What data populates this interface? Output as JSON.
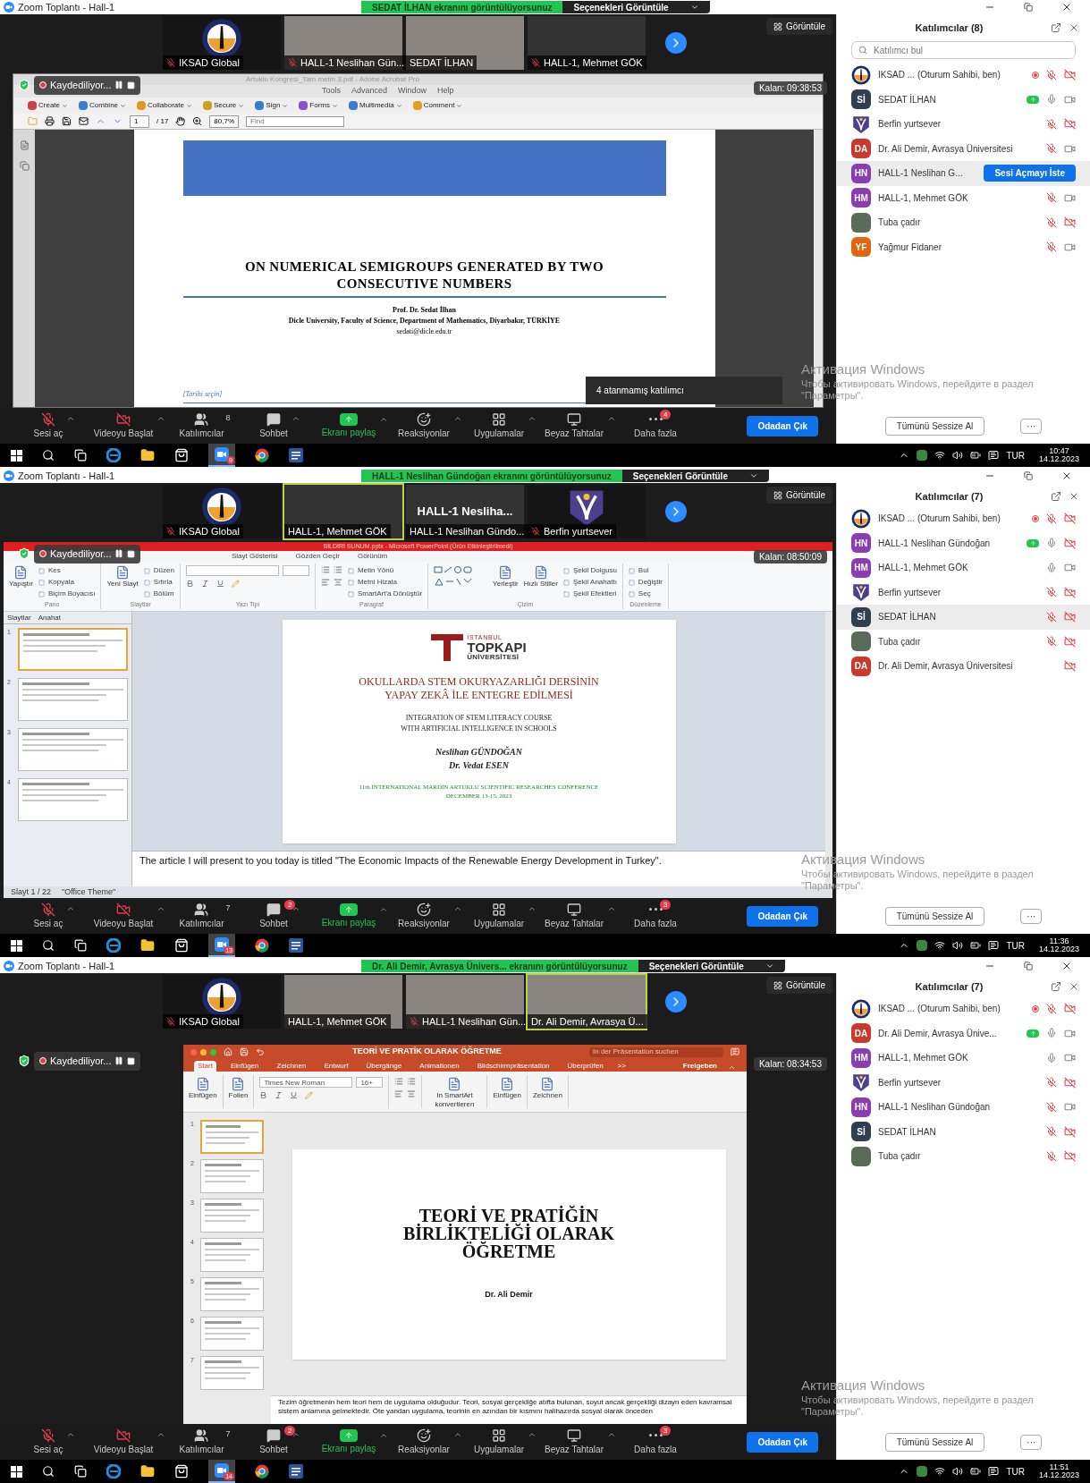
{
  "panels": [
    {
      "window_title": "Zoom Toplantı - Hall-1",
      "banner": "SEDAT İLHAN ekranını görüntülüyorsunuz",
      "options": "Seçenekleri Görüntüle",
      "view": "Görüntüle",
      "tiles": [
        {
          "kind": "logo",
          "name": "IKSAD Global",
          "muted": true,
          "speaking": false
        },
        {
          "kind": "video",
          "name": "HALL-1 Neslihan Gün...",
          "muted": true,
          "speaking": false
        },
        {
          "kind": "video",
          "name": "SEDAT İLHAN",
          "muted": false,
          "speaking": false
        },
        {
          "kind": "blank",
          "name": "HALL-1, Mehmet GÖK",
          "muted": true,
          "speaking": false
        }
      ],
      "recording": "Kaydediliyor...",
      "remaining": "Kalan: 09:38:53",
      "shared": {
        "kind": "pdf",
        "title": "Artuklu Kongresi_Tam metin 3.pdf - Adobe Acrobat Pro",
        "menus": [
          "Tools",
          "Advanced",
          "Window",
          "Help"
        ],
        "tools": [
          "Create",
          "Combine",
          "Collaborate",
          "Secure",
          "Sign",
          "Forms",
          "Multimedia",
          "Comment"
        ],
        "page": "1",
        "pages": "/ 17",
        "zoom": "80,7%",
        "find": {
          "placeholder": "Find"
        },
        "doc": {
          "title": "ON NUMERICAL SEMIGROUPS GENERATED BY TWO CONSECUTIVE NUMBERS",
          "author": "Prof. Dr. Sedat İlhan",
          "affiliation": "Dicle University, Faculty of Science, Department of Mathematics, Diyarbakır, TÜRKİYE",
          "email": "sedati@dicle.edu.tr",
          "date_field": "[Tarihi seçin]"
        }
      },
      "tooltip": "4 atanmamış katılımcı",
      "toolbar": [
        {
          "kind": "mic-off",
          "label": "Sesi aç",
          "caret": true
        },
        {
          "kind": "video-off",
          "label": "Videoyu Başlat",
          "caret": true
        },
        {
          "kind": "people",
          "label": "Katılımcılar",
          "count": "8",
          "caret": false
        },
        {
          "kind": "chat",
          "label": "Sohbet",
          "caret": true
        },
        {
          "kind": "share",
          "label": "Ekranı paylaş",
          "caret": true
        },
        {
          "kind": "reaction",
          "label": "Reaksiyonlar",
          "caret": true
        },
        {
          "kind": "apps",
          "label": "Uygulamalar",
          "caret": true
        },
        {
          "kind": "whiteboard",
          "label": "Beyaz Tahtalar",
          "caret": true
        },
        {
          "kind": "more",
          "label": "Daha fazla",
          "badge": "4",
          "caret": false
        }
      ],
      "leave": "Odadan Çık",
      "participants": {
        "title": "Katılımcılar (8)",
        "search": {
          "placeholder": "Katılımcı bul"
        },
        "items": [
          {
            "kind": "logo",
            "name": "IKSAD ...  (Oturum Sahibi, ben)",
            "recording": true,
            "sharing": false,
            "mic_muted": true,
            "video_off": true,
            "selected": false
          },
          {
            "kind": "initials",
            "initials": "Sİ",
            "color": "#2f3e50",
            "name": "SEDAT İLHAN",
            "recording": false,
            "sharing": true,
            "mic_muted": false,
            "video_off": false,
            "selected": false
          },
          {
            "kind": "emblem",
            "name": "Berfin yurtsever",
            "recording": false,
            "sharing": false,
            "mic_muted": true,
            "video_off": true,
            "selected": false
          },
          {
            "kind": "initials",
            "initials": "DA",
            "color": "#c83a2e",
            "name": "Dr. Ali Demir, Avrasya Üniversitesi",
            "recording": false,
            "sharing": false,
            "mic_muted": true,
            "video_off": false,
            "selected": false
          },
          {
            "kind": "initials",
            "initials": "HN",
            "color": "#8a3db0",
            "name": "HALL-1 Neslihan G...",
            "recording": false,
            "sharing": false,
            "selected": true,
            "action": "Sesi Açmayı İste"
          },
          {
            "kind": "initials",
            "initials": "HM",
            "color": "#8a3db0",
            "name": "HALL-1, Mehmet GÖK",
            "recording": false,
            "sharing": false,
            "mic_muted": true,
            "video_off": false,
            "selected": false
          },
          {
            "kind": "photo",
            "name": "Tuba çadır",
            "recording": false,
            "sharing": false,
            "mic_muted": true,
            "video_off": true,
            "selected": false
          },
          {
            "kind": "initials",
            "initials": "YF",
            "color": "#e0650f",
            "name": "Yağmur Fidaner",
            "recording": false,
            "sharing": false,
            "mic_muted": true,
            "video_off": false,
            "selected": false
          }
        ],
        "mute_all": "Tümünü Sessize Al",
        "more": "···"
      },
      "activation": {
        "title": "Активация Windows",
        "text": "Чтобы активировать Windows, перейдите в раздел \"Параметры\"."
      },
      "taskbar": {
        "zoom_badge": "9",
        "lang": "TUR",
        "time": "10:47",
        "date": "14.12.2023"
      }
    },
    {
      "window_title": "Zoom Toplantı - Hall-1",
      "banner": "HALL-1 Neslihan Gündoğan ekranını görüntülüyorsunuz",
      "options": "Seçenekleri Görüntüle",
      "view": "Görüntüle",
      "tiles": [
        {
          "kind": "logo",
          "name": "IKSAD Global",
          "muted": true,
          "speaking": false
        },
        {
          "kind": "blank",
          "name": "HALL-1, Mehmet GÖK",
          "muted": false,
          "speaking": true
        },
        {
          "kind": "name",
          "big_name": "HALL-1  Nesliha...",
          "name": "HALL-1 Neslihan Gündo...",
          "muted": false,
          "speaking": false
        },
        {
          "kind": "emblem",
          "name": "Berfin yurtsever",
          "muted": true,
          "speaking": false
        }
      ],
      "recording": "Kaydediliyor...",
      "remaining": "Kalan: 08:50:09",
      "shared": {
        "kind": "ppt-win",
        "title": "BİLDİRİ SUNUM.pptx - Microsoft PowerPoint (Ürün Etkinleştirilmedi)",
        "tabs": [
          "Slayt Gösterisi",
          "Gözden Geçir",
          "Görünüm"
        ],
        "groups": [
          {
            "kind": "buttons",
            "label": "Pano",
            "big": [
              "Yapıştır"
            ],
            "items": [
              "Kes",
              "Kopyala",
              "Biçim Boyacısı"
            ]
          },
          {
            "kind": "buttons",
            "label": "Slaytlar",
            "big": [
              "Yeni Slayt"
            ],
            "items": [
              "Düzen",
              "Sıfırla",
              "Bölüm"
            ]
          },
          {
            "kind": "font",
            "label": "Yazı Tipi"
          },
          {
            "kind": "paragraph",
            "label": "Paragraf",
            "items": [
              "Metin Yönü",
              "Metni Hizala",
              "SmartArt'a Dönüştür"
            ]
          },
          {
            "kind": "shapes",
            "label": "Çizim",
            "big": [
              "Yerleştir",
              "Hızlı Stiller"
            ],
            "items": [
              "Şekil Dolgusu",
              "Şekil Anahattı",
              "Şekil Efektleri"
            ]
          },
          {
            "kind": "buttons",
            "label": "Düzenleme",
            "items": [
              "Bul",
              "Değiştir",
              "Seç"
            ]
          }
        ],
        "pane_tabs": [
          "Slaytlar",
          "Anahat"
        ],
        "thumbs": [
          {
            "number": "1",
            "selected": true
          },
          {
            "number": "2",
            "selected": false
          },
          {
            "number": "3",
            "selected": false
          },
          {
            "number": "4",
            "selected": false
          }
        ],
        "slide": {
          "kind": "topkapi",
          "logo": [
            "İSTANBUL",
            "TOPKAPI",
            "ÜNİVERSİTESİ"
          ],
          "title": [
            "OKULLARDA STEM OKURYAZARLIĞI DERSİNİN",
            "YAPAY ZEKÂ İLE ENTEGRE EDİLMESİ"
          ],
          "subtitle": [
            "INTEGRATION OF STEM LITERACY COURSE",
            "WITH ARTIFICIAL INTELLIGENCE IN SCHOOLS"
          ],
          "authors": [
            "Neslihan GÜNDOĞAN",
            "Dr. Vedat ESEN"
          ],
          "footer": [
            "11th INTERNATIONAL MARDİN ARTUKLU SCIENTIFIC RESEARCHES CONFERENCE",
            "DECEMBER 13-15, 2023"
          ]
        },
        "notes": "The article I will present to you today is titled \"The Economic Impacts of the Renewable Energy Development in Turkey\".",
        "status": [
          "Slayt 1 / 22",
          "\"Office Theme\""
        ]
      },
      "toolbar": [
        {
          "kind": "mic-off",
          "label": "Sesi aç",
          "caret": true
        },
        {
          "kind": "video-off",
          "label": "Videoyu Başlat",
          "caret": true
        },
        {
          "kind": "people",
          "label": "Katılımcılar",
          "count": "7",
          "caret": false
        },
        {
          "kind": "chat",
          "label": "Sohbet",
          "badge": "2",
          "caret": true
        },
        {
          "kind": "share",
          "label": "Ekranı paylaş",
          "caret": true
        },
        {
          "kind": "reaction",
          "label": "Reaksiyonlar",
          "caret": true
        },
        {
          "kind": "apps",
          "label": "Uygulamalar",
          "caret": true
        },
        {
          "kind": "whiteboard",
          "label": "Beyaz Tahtalar",
          "caret": true
        },
        {
          "kind": "more",
          "label": "Daha fazla",
          "badge": "3",
          "caret": false
        }
      ],
      "leave": "Odadan Çık",
      "participants": {
        "title": "Katılımcılar (7)",
        "items": [
          {
            "kind": "logo",
            "name": "IKSAD ...  (Oturum Sahibi, ben)",
            "recording": true,
            "sharing": false,
            "mic_muted": true,
            "video_off": true,
            "selected": false
          },
          {
            "kind": "initials",
            "initials": "HN",
            "color": "#8a3db0",
            "name": "HALL-1 Neslihan Gündoğan",
            "recording": false,
            "sharing": true,
            "mic_muted": false,
            "video_off": true,
            "selected": false
          },
          {
            "kind": "initials",
            "initials": "HM",
            "color": "#8a3db0",
            "name": "HALL-1, Mehmet GÖK",
            "recording": false,
            "sharing": false,
            "mic_muted": false,
            "video_off": false,
            "selected": false
          },
          {
            "kind": "emblem",
            "name": "Berfin yurtsever",
            "recording": false,
            "sharing": false,
            "mic_muted": true,
            "video_off": true,
            "selected": false
          },
          {
            "kind": "initials",
            "initials": "Sİ",
            "color": "#2f3e50",
            "name": "SEDAT İLHAN",
            "recording": false,
            "sharing": false,
            "mic_muted": true,
            "video_off": true,
            "selected": true
          },
          {
            "kind": "photo",
            "name": "Tuba çadır",
            "recording": false,
            "sharing": false,
            "mic_muted": true,
            "video_off": true,
            "selected": false
          },
          {
            "kind": "initials",
            "initials": "DA",
            "color": "#c83a2e",
            "name": "Dr. Ali Demir, Avrasya Üniversitesi",
            "recording": false,
            "sharing": false,
            "video_off": true,
            "selected": false
          }
        ],
        "mute_all": "Tümünü Sessize Al",
        "more": "···"
      },
      "activation": {
        "title": "Активация Windows",
        "text": "Чтобы активировать Windows, перейдите в раздел \"Параметры\"."
      },
      "taskbar": {
        "zoom_badge": "13",
        "lang": "TUR",
        "time": "11:36",
        "date": "14.12.2023"
      }
    },
    {
      "window_title": "Zoom Toplantı - Hall-1",
      "banner": "Dr. Ali Demir, Avrasya Ünivers... ekranını görüntülüyorsunuz",
      "options": "Seçenekleri Görüntüle",
      "view": "Görüntüle",
      "tiles": [
        {
          "kind": "logo",
          "name": "IKSAD Global",
          "muted": true,
          "speaking": false
        },
        {
          "kind": "video",
          "name": "HALL-1, Mehmet GÖK",
          "muted": false,
          "speaking": false
        },
        {
          "kind": "video",
          "name": "HALL-1 Neslihan Gün...",
          "muted": true,
          "speaking": false
        },
        {
          "kind": "video",
          "name": "Dr. Ali Demir, Avrasya Ü...",
          "muted": false,
          "speaking": true
        }
      ],
      "recording": "Kaydediliyor...",
      "remaining": "Kalan: 08:34:53",
      "shared": {
        "kind": "ppt-mac",
        "title": "TEORİ VE PRATİK OLARAK ÖĞRETME",
        "search": {
          "placeholder": "In der Präsentation suchen"
        },
        "tabs": [
          {
            "label": "Start",
            "selected": true
          },
          {
            "label": "Einfügen",
            "selected": false
          },
          {
            "label": "Zeichnen",
            "selected": false
          },
          {
            "label": "Entwurf",
            "selected": false
          },
          {
            "label": "Übergänge",
            "selected": false
          },
          {
            "label": "Animationen",
            "selected": false
          },
          {
            "label": "Bildschirmpräsentation",
            "selected": false
          },
          {
            "label": "Überprüfen",
            "selected": false
          }
        ],
        "more": ">>",
        "share": "Freigeben",
        "groups": [
          {
            "kind": "buttons",
            "big": [
              "Einfügen"
            ]
          },
          {
            "kind": "buttons",
            "big": [
              "Folien"
            ]
          },
          {
            "kind": "font",
            "font": "Times New Roman",
            "size": "16+"
          },
          {
            "kind": "paragraph"
          },
          {
            "kind": "buttons",
            "big": [
              "In SmartArt konvertieren"
            ]
          },
          {
            "kind": "buttons",
            "big": [
              "Einfügen"
            ]
          },
          {
            "kind": "buttons",
            "big": [
              "Zeichnen"
            ]
          }
        ],
        "thumbs": [
          {
            "number": "1",
            "selected": true
          },
          {
            "number": "2",
            "selected": false
          },
          {
            "number": "3",
            "selected": false
          },
          {
            "number": "4",
            "selected": false
          },
          {
            "number": "5",
            "selected": false
          },
          {
            "number": "6",
            "selected": false
          },
          {
            "number": "7",
            "selected": false
          }
        ],
        "slide": {
          "kind": "plain",
          "title": [
            "TEORİ VE PRATİĞİN",
            "BİRLİKTELİĞİ OLARAK",
            "ÖĞRETME"
          ],
          "authors": [
            "Dr. Ali Demir"
          ]
        },
        "notes": "Tezim öğretmenin hem teori hem de uygulama olduğudur. Teori, sosyal gerçekliğe atıfta bulunan, soyut ancak gerçekliği dizayn eden kavramsal sistem anlamına gelmektedir. Öte yandan uygulama, teorinin en azından bir kısmını halihazırda sosyal olarak önceden"
      },
      "toolbar": [
        {
          "kind": "mic-off",
          "label": "Sesi aç",
          "caret": true
        },
        {
          "kind": "video-off",
          "label": "Videoyu Başlat",
          "caret": true
        },
        {
          "kind": "people",
          "label": "Katılımcılar",
          "count": "7",
          "caret": false
        },
        {
          "kind": "chat",
          "label": "Sohbet",
          "badge": "2",
          "caret": true
        },
        {
          "kind": "share",
          "label": "Ekranı paylaş",
          "caret": true
        },
        {
          "kind": "reaction",
          "label": "Reaksiyonlar",
          "caret": true
        },
        {
          "kind": "apps",
          "label": "Uygulamalar",
          "caret": true
        },
        {
          "kind": "whiteboard",
          "label": "Beyaz Tahtalar",
          "caret": true
        },
        {
          "kind": "more",
          "label": "Daha fazla",
          "badge": "3",
          "caret": false
        }
      ],
      "leave": "Odadan Çık",
      "participants": {
        "title": "Katılımcılar (7)",
        "items": [
          {
            "kind": "logo",
            "name": "IKSAD ...  (Oturum Sahibi, ben)",
            "recording": true,
            "sharing": false,
            "mic_muted": true,
            "video_off": true,
            "selected": false
          },
          {
            "kind": "initials",
            "initials": "DA",
            "color": "#c83a2e",
            "name": "Dr. Ali Demir, Avrasya Ünive...",
            "recording": false,
            "sharing": true,
            "mic_muted": false,
            "video_off": false,
            "selected": false
          },
          {
            "kind": "initials",
            "initials": "HM",
            "color": "#8a3db0",
            "name": "HALL-1, Mehmet GÖK",
            "recording": false,
            "sharing": false,
            "mic_muted": false,
            "video_off": false,
            "selected": false
          },
          {
            "kind": "emblem",
            "name": "Berfin yurtsever",
            "recording": false,
            "sharing": false,
            "mic_muted": true,
            "video_off": true,
            "selected": false
          },
          {
            "kind": "initials",
            "initials": "HN",
            "color": "#8a3db0",
            "name": "HALL-1 Neslihan Gündoğan",
            "recording": false,
            "sharing": false,
            "mic_muted": true,
            "video_off": false,
            "selected": false
          },
          {
            "kind": "initials",
            "initials": "Sİ",
            "color": "#2f3e50",
            "name": "SEDAT İLHAN",
            "recording": false,
            "sharing": false,
            "mic_muted": true,
            "video_off": true,
            "selected": false
          },
          {
            "kind": "photo",
            "name": "Tuba çadır",
            "recording": false,
            "sharing": false,
            "mic_muted": true,
            "video_off": true,
            "selected": false
          }
        ],
        "mute_all": "Tümünü Sessize Al",
        "more": "···"
      },
      "activation": {
        "title": "Активация Windows",
        "text": "Чтобы активировать Windows, перейдите в раздел \"Параметры\"."
      },
      "taskbar": {
        "zoom_badge": "14",
        "lang": "TUR",
        "time": "11:51",
        "date": "14.12.2023"
      }
    }
  ]
}
